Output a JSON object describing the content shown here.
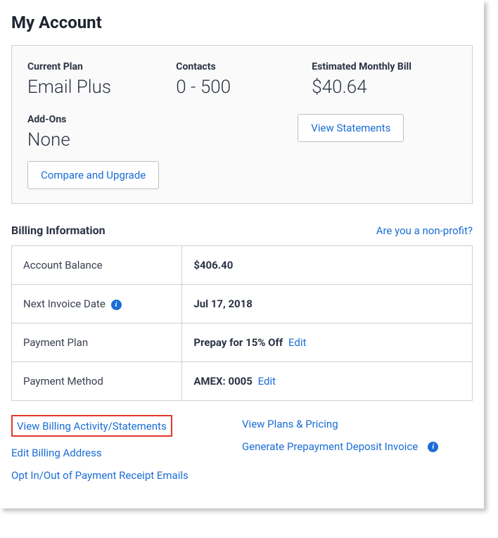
{
  "page": {
    "title": "My Account"
  },
  "plan": {
    "current_plan_label": "Current Plan",
    "current_plan_value": "Email Plus",
    "contacts_label": "Contacts",
    "contacts_value": "0 - 500",
    "est_bill_label": "Estimated Monthly Bill",
    "est_bill_value": "$40.64",
    "addons_label": "Add-Ons",
    "addons_value": "None",
    "compare_button": "Compare and Upgrade",
    "view_statements_button": "View Statements"
  },
  "billing": {
    "section_title": "Billing Information",
    "nonprofit_link": "Are you a non-profit?",
    "rows": {
      "balance_label": "Account Balance",
      "balance_value": "$406.40",
      "next_invoice_label": "Next Invoice Date",
      "next_invoice_value": "Jul 17, 2018",
      "payment_plan_label": "Payment Plan",
      "payment_plan_value": "Prepay for 15% Off",
      "payment_plan_edit": "Edit",
      "payment_method_label": "Payment Method",
      "payment_method_value": "AMEX: 0005",
      "payment_method_edit": "Edit"
    }
  },
  "bottom_links": {
    "view_billing_activity": "View Billing Activity/Statements",
    "edit_billing_address": "Edit Billing Address",
    "opt_receipt_emails": "Opt In/Out of Payment Receipt Emails",
    "view_plans_pricing": "View Plans & Pricing",
    "generate_prepay_invoice": "Generate Prepayment Deposit Invoice"
  }
}
